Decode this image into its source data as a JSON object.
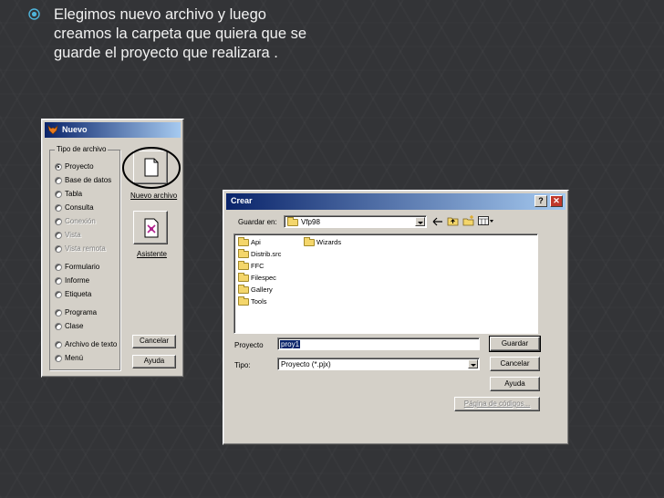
{
  "slide": {
    "bullet_text": "Elegimos nuevo archivo y luego\ncreamos la carpeta que quiera que se\nguarde el proyecto que realizara ."
  },
  "nuevo_dialog": {
    "title": "Nuevo",
    "group_label": "Tipo de archivo",
    "options": [
      {
        "label": "Proyecto",
        "selected": true,
        "disabled": false
      },
      {
        "label": "Base de datos",
        "selected": false,
        "disabled": false
      },
      {
        "label": "Tabla",
        "selected": false,
        "disabled": false
      },
      {
        "label": "Consulta",
        "selected": false,
        "disabled": false
      },
      {
        "label": "Conexión",
        "selected": false,
        "disabled": true
      },
      {
        "label": "Vista",
        "selected": false,
        "disabled": true
      },
      {
        "label": "Vista remota",
        "selected": false,
        "disabled": true
      },
      {
        "label": "Formulario",
        "selected": false,
        "disabled": false
      },
      {
        "label": "Informe",
        "selected": false,
        "disabled": false
      },
      {
        "label": "Etiqueta",
        "selected": false,
        "disabled": false
      },
      {
        "label": "Programa",
        "selected": false,
        "disabled": false
      },
      {
        "label": "Clase",
        "selected": false,
        "disabled": false
      },
      {
        "label": "Archivo de texto",
        "selected": false,
        "disabled": false
      },
      {
        "label": "Menú",
        "selected": false,
        "disabled": false
      }
    ],
    "new_file_label": "Nuevo archivo",
    "wizard_label": "Asistente",
    "cancel_label": "Cancelar",
    "help_label": "Ayuda"
  },
  "crear_dialog": {
    "title": "Crear",
    "save_in_label": "Guardar en:",
    "save_in_value": "Vfp98",
    "folders_col1": [
      "Api",
      "Distrib.src",
      "FFC",
      "Filespec",
      "Gallery",
      "Tools"
    ],
    "folders_col2": [
      "Wizards"
    ],
    "project_label": "Proyecto",
    "project_value": "proy1",
    "type_label": "Tipo:",
    "type_value": "Proyecto (*.pjx)",
    "save_label": "Guardar",
    "cancel_label": "Cancelar",
    "help_label": "Ayuda",
    "codepage_label": "Página de códigos..."
  },
  "colors": {
    "background": "#333437",
    "titlebar_start": "#0a246a",
    "titlebar_end": "#a6caf0",
    "dialog_face": "#d4d0c8",
    "close_button": "#c0392b",
    "bullet": "#4fb3d9"
  }
}
